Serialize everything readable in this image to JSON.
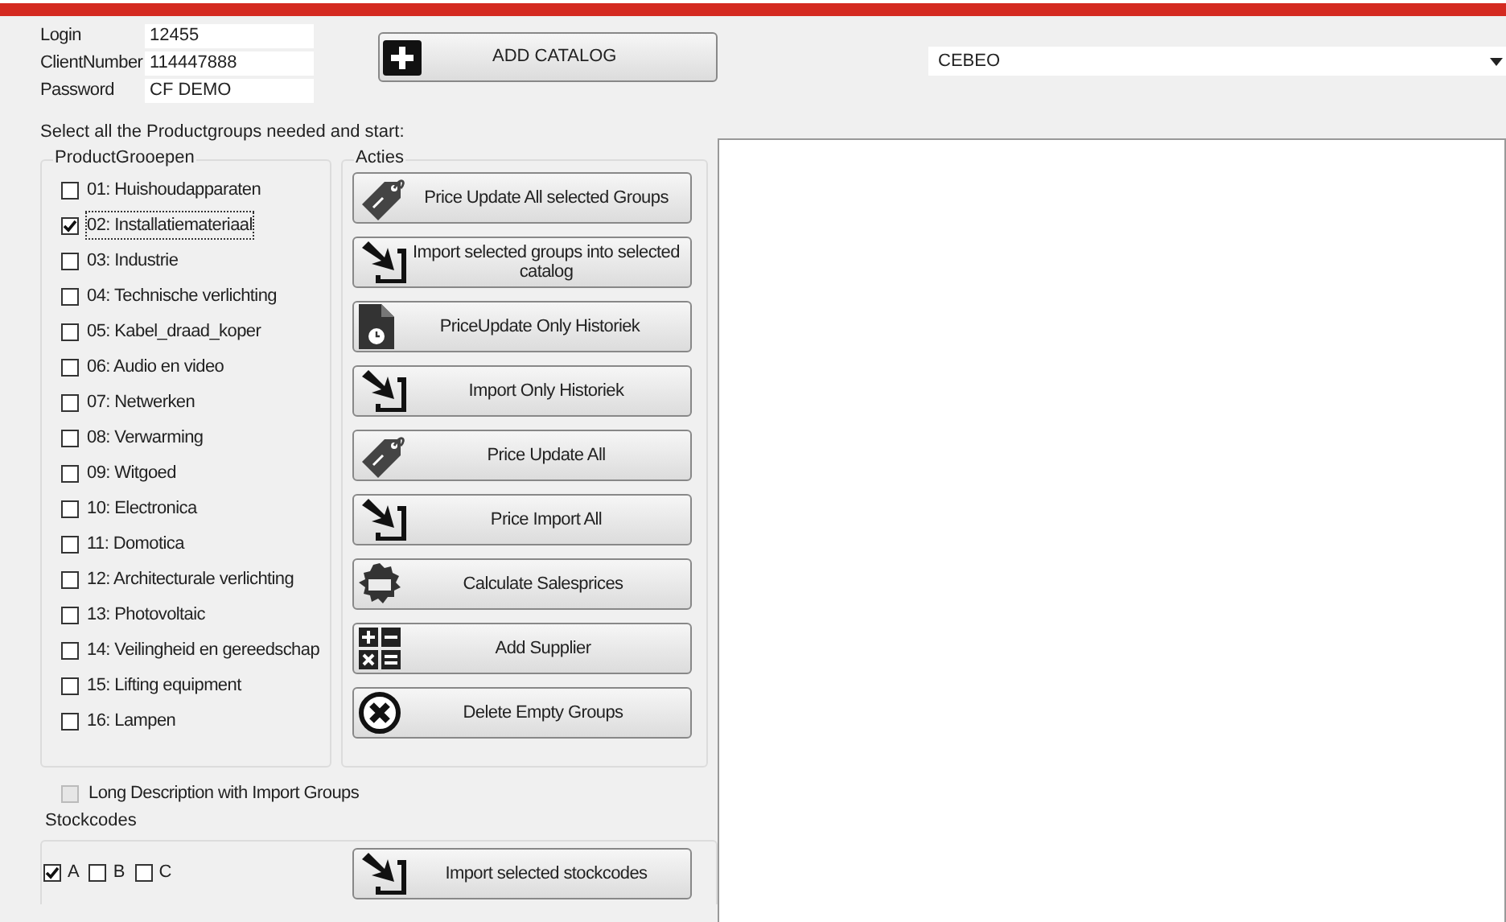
{
  "credentials": [
    {
      "label": "Login",
      "value": "12455"
    },
    {
      "label": "ClientNumber",
      "value": "114447888"
    },
    {
      "label": "Password",
      "value": "CF DEMO"
    }
  ],
  "add_catalog_button": {
    "label": "ADD CATALOG"
  },
  "catalog_dropdown": {
    "value": "CEBEO"
  },
  "instruction": "Select all the Productgroups needed and start:",
  "product_groups": {
    "title": "ProductGrooepen",
    "items": [
      {
        "label": "01: Huishoudapparaten",
        "checked": false,
        "focused": false
      },
      {
        "label": "02: Installatiemateriaal",
        "checked": true,
        "focused": true
      },
      {
        "label": "03: Industrie",
        "checked": false,
        "focused": false
      },
      {
        "label": "04: Technische verlichting",
        "checked": false,
        "focused": false
      },
      {
        "label": "05: Kabel_draad_koper",
        "checked": false,
        "focused": false
      },
      {
        "label": "06: Audio en video",
        "checked": false,
        "focused": false
      },
      {
        "label": "07: Netwerken",
        "checked": false,
        "focused": false
      },
      {
        "label": "08: Verwarming",
        "checked": false,
        "focused": false
      },
      {
        "label": "09: Witgoed",
        "checked": false,
        "focused": false
      },
      {
        "label": "10: Electronica",
        "checked": false,
        "focused": false
      },
      {
        "label": "11: Domotica",
        "checked": false,
        "focused": false
      },
      {
        "label": "12: Architecturale verlichting",
        "checked": false,
        "focused": false
      },
      {
        "label": "13: Photovoltaic",
        "checked": false,
        "focused": false
      },
      {
        "label": "14: Veilingheid en gereedschap",
        "checked": false,
        "focused": false
      },
      {
        "label": "15: Lifting equipment",
        "checked": false,
        "focused": false
      },
      {
        "label": "16: Lampen",
        "checked": false,
        "focused": false
      }
    ]
  },
  "actions": {
    "title": "Acties",
    "buttons": [
      {
        "label": "Price Update All selected Groups",
        "kind": "tag"
      },
      {
        "label": "Import selected groups into selected catalog",
        "kind": "import"
      },
      {
        "label": "PriceUpdate Only Historiek",
        "kind": "document"
      },
      {
        "label": "Import Only Historiek",
        "kind": "import"
      },
      {
        "label": "Price Update All",
        "kind": "tag"
      },
      {
        "label": "Price Import All",
        "kind": "import"
      },
      {
        "label": "Calculate Salesprices",
        "kind": "sale"
      },
      {
        "label": "Add Supplier",
        "kind": "calculator"
      },
      {
        "label": "Delete Empty Groups",
        "kind": "delete"
      }
    ]
  },
  "long_description": {
    "label": "Long Description with Import Groups",
    "checked": false,
    "disabled": true
  },
  "stockcodes": {
    "title": "Stockcodes",
    "items": [
      {
        "label": "A",
        "checked": true
      },
      {
        "label": "B",
        "checked": false
      },
      {
        "label": "C",
        "checked": false
      }
    ],
    "button": {
      "label": "Import selected stockcodes",
      "kind": "import"
    }
  }
}
